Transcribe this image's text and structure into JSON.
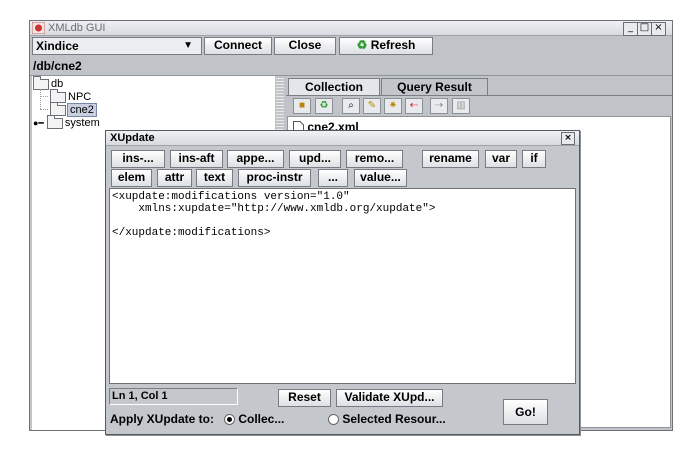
{
  "window": {
    "title": "XMLdb GUI",
    "minimize": "_",
    "maximize": "□",
    "close": "×"
  },
  "toolbar": {
    "database": "Xindice",
    "connect_label": "Connect",
    "close_label": "Close",
    "refresh_label": "Refresh"
  },
  "path": "/db/cne2",
  "tree": {
    "root": "db",
    "children": [
      "NPC",
      "cne2",
      "system"
    ]
  },
  "tabs": [
    "Collection",
    "Query Result"
  ],
  "files": [
    "cne2.xml"
  ],
  "dialog": {
    "title": "XUpdate",
    "close": "×",
    "row1": [
      "ins-...",
      "ins-aft",
      "appe...",
      "upd...",
      "remo...",
      "rename",
      "var",
      "if"
    ],
    "row2": [
      "elem",
      "attr",
      "text",
      "proc-instr",
      "...",
      "value..."
    ],
    "editor_lines": [
      "<xupdate:modifications version=\"1.0\"",
      "    xmlns:xupdate=\"http://www.xmldb.org/xupdate\">",
      "",
      "</xupdate:modifications>"
    ],
    "status": "Ln 1, Col 1",
    "reset_label": "Reset",
    "validate_label": "Validate XUpd...",
    "apply_label": "Apply XUpdate to:",
    "option_collection": "Collec...",
    "option_selected": "Selected Resour...",
    "go_label": "Go!"
  }
}
